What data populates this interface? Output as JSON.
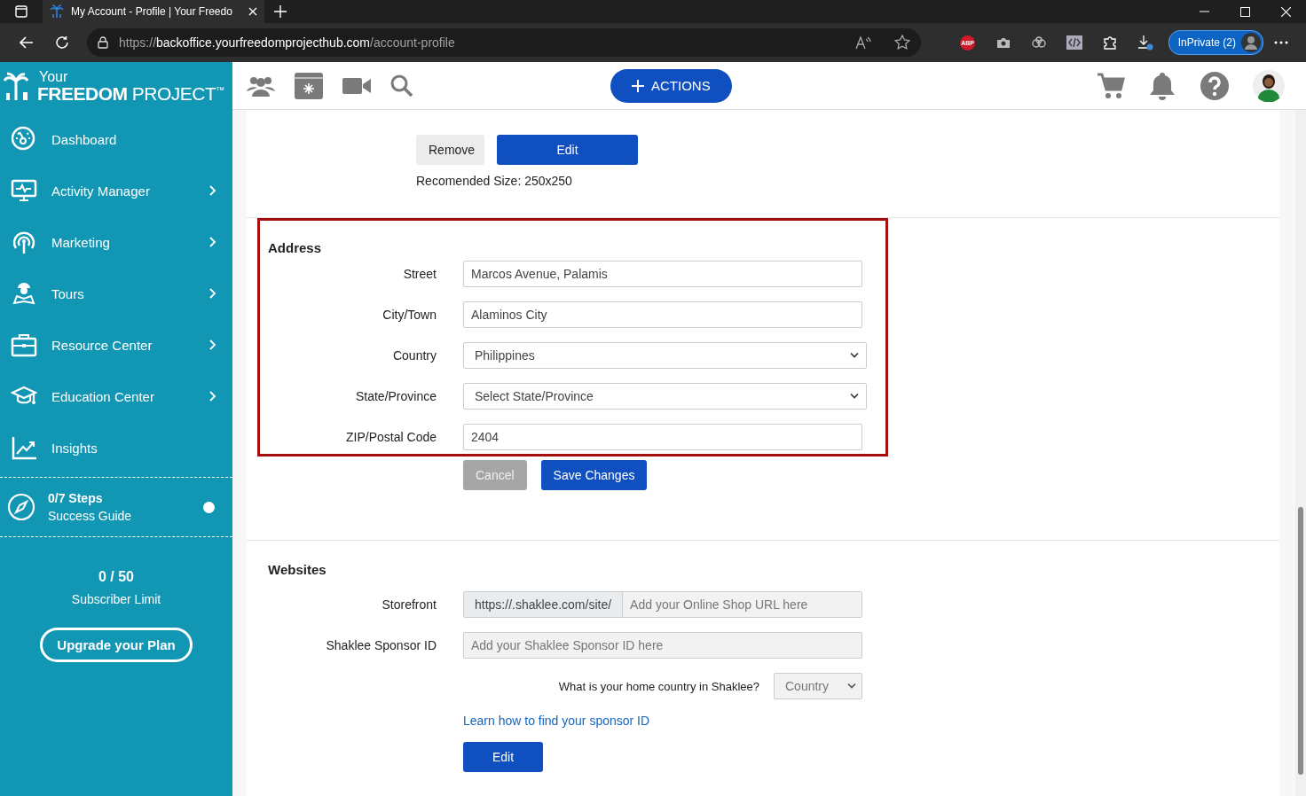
{
  "browser": {
    "tab_title": "My Account - Profile | Your Freedo",
    "url_scheme": "https://",
    "url_host": "backoffice.yourfreedomprojecthub.com",
    "url_path": "/account-profile",
    "adblock_badge": "ABP",
    "profile_button": "InPrivate (2)"
  },
  "logo": {
    "top": "Your",
    "brand_bold": "FREEDOM",
    "brand_light": "PROJECT",
    "mark": "™"
  },
  "sidebar": {
    "items": [
      {
        "label": "Dashboard",
        "has_submenu": false
      },
      {
        "label": "Activity Manager",
        "has_submenu": true
      },
      {
        "label": "Marketing",
        "has_submenu": true
      },
      {
        "label": "Tours",
        "has_submenu": true
      },
      {
        "label": "Resource Center",
        "has_submenu": true
      },
      {
        "label": "Education Center",
        "has_submenu": true
      },
      {
        "label": "Insights",
        "has_submenu": false
      }
    ],
    "guide": {
      "steps": "0/7 Steps",
      "label": "Success Guide",
      "done": false
    },
    "subscribers": {
      "count": "0 / 50",
      "label": "Subscriber Limit"
    },
    "upgrade_button": "Upgrade your Plan"
  },
  "header": {
    "actions_button": "ACTIONS"
  },
  "photo": {
    "remove_button": "Remove",
    "edit_button": "Edit",
    "note": "Recomended Size: 250x250"
  },
  "address": {
    "title": "Address",
    "highlighted": true,
    "fields": [
      {
        "label": "Street",
        "kind": "text",
        "value": "Marcos Avenue, Palamis"
      },
      {
        "label": "City/Town",
        "kind": "text",
        "value": "Alaminos City"
      },
      {
        "label": "Country",
        "kind": "select",
        "value": "Philippines"
      },
      {
        "label": "State/Province",
        "kind": "select",
        "value": "Select State/Province"
      },
      {
        "label": "ZIP/Postal Code",
        "kind": "text",
        "value": "2404"
      }
    ],
    "cancel_button": "Cancel",
    "save_button": "Save Changes"
  },
  "websites": {
    "title": "Websites",
    "storefront": {
      "label": "Storefront",
      "prefix": "https://.shaklee.com/site/",
      "placeholder": "Add your Online Shop URL here"
    },
    "sponsor": {
      "label": "Shaklee Sponsor ID",
      "placeholder": "Add your Shaklee Sponsor ID here"
    },
    "country_question": {
      "label": "What is your home country in Shaklee?",
      "value": "Country"
    },
    "help_link": "Learn how to find your sponsor ID",
    "edit_button": "Edit"
  }
}
